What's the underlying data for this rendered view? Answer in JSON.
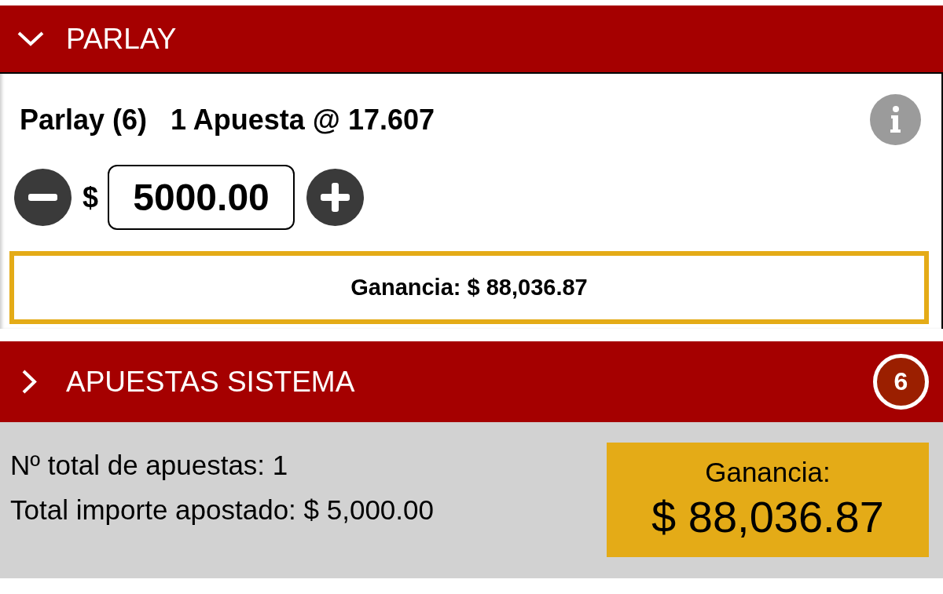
{
  "parlay": {
    "header": {
      "title": "PARLAY",
      "expanded": true
    },
    "bet_type": "Parlay (6)",
    "bet_summary": "1 Apuesta @ 17.607",
    "stake": {
      "currency": "$",
      "value": "5000.00"
    },
    "winnings": "Ganancia: $ 88,036.87"
  },
  "system_bets": {
    "header": {
      "title": "APUESTAS SISTEMA",
      "expanded": false
    },
    "count": "6"
  },
  "totals": {
    "lines": [
      "Nº total de apuestas: 1",
      "Total importe apostado: $ 5,000.00"
    ],
    "winnings_label": "Ganancia:",
    "winnings_value": "$ 88,036.87"
  }
}
